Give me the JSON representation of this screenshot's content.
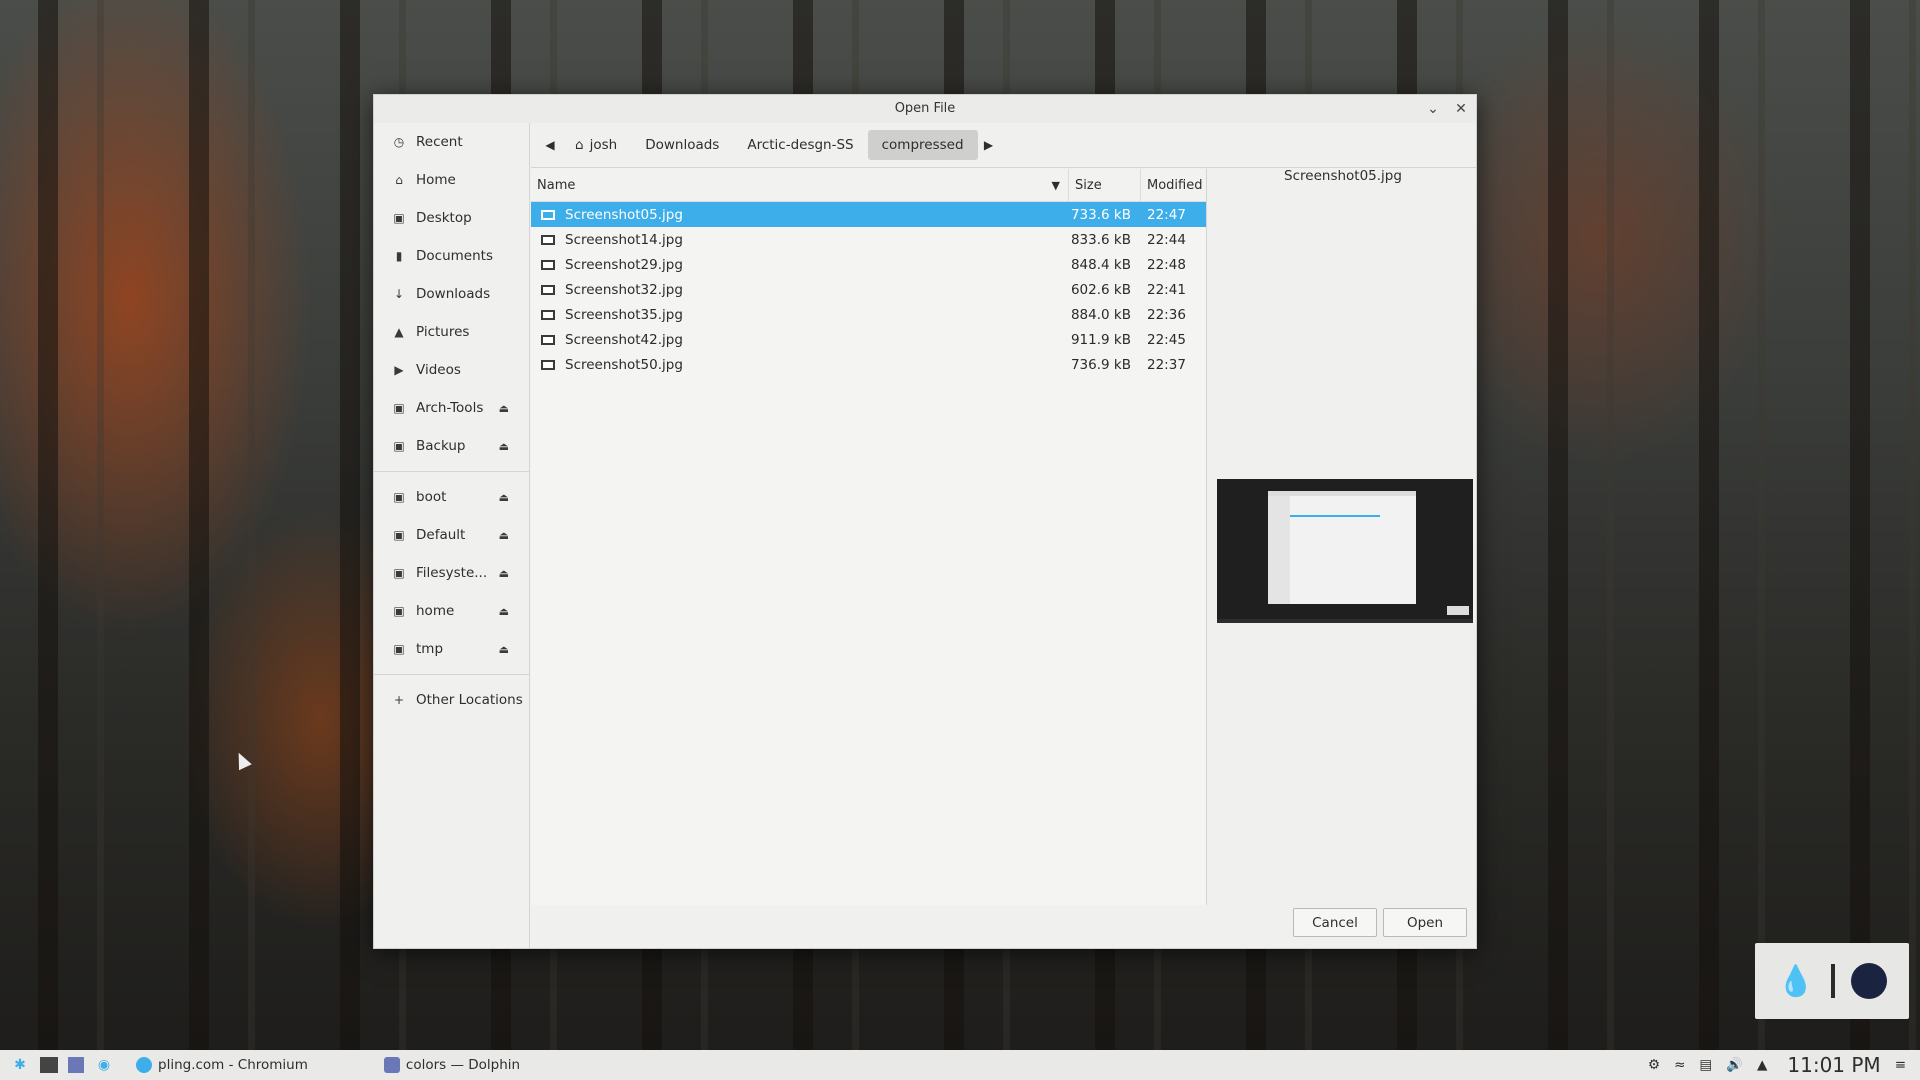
{
  "dialog": {
    "title": "Open File",
    "cancel_label": "Cancel",
    "open_label": "Open"
  },
  "sidebar": {
    "places": [
      {
        "label": "Recent",
        "icon": "clock-icon"
      },
      {
        "label": "Home",
        "icon": "home-icon"
      },
      {
        "label": "Desktop",
        "icon": "desktop-icon"
      },
      {
        "label": "Documents",
        "icon": "document-icon"
      },
      {
        "label": "Downloads",
        "icon": "download-icon"
      },
      {
        "label": "Pictures",
        "icon": "picture-icon"
      },
      {
        "label": "Videos",
        "icon": "video-icon"
      },
      {
        "label": "Arch-Tools",
        "icon": "drive-icon"
      },
      {
        "label": "Backup",
        "icon": "drive-icon"
      }
    ],
    "devices": [
      {
        "label": "boot"
      },
      {
        "label": "Default"
      },
      {
        "label": "Filesyste..."
      },
      {
        "label": "home"
      },
      {
        "label": "tmp"
      }
    ],
    "other_locations": "Other Locations"
  },
  "pathbar": {
    "crumbs": [
      "josh",
      "Downloads",
      "Arctic-desgn-SS",
      "compressed"
    ],
    "active": "compressed"
  },
  "filelist": {
    "columns": {
      "name": "Name",
      "size": "Size",
      "modified": "Modified"
    },
    "rows": [
      {
        "name": "Screenshot05.jpg",
        "size": "733.6 kB",
        "modified": "22:47",
        "selected": true
      },
      {
        "name": "Screenshot14.jpg",
        "size": "833.6 kB",
        "modified": "22:44"
      },
      {
        "name": "Screenshot29.jpg",
        "size": "848.4 kB",
        "modified": "22:48"
      },
      {
        "name": "Screenshot32.jpg",
        "size": "602.6 kB",
        "modified": "22:41"
      },
      {
        "name": "Screenshot35.jpg",
        "size": "884.0 kB",
        "modified": "22:36"
      },
      {
        "name": "Screenshot42.jpg",
        "size": "911.9 kB",
        "modified": "22:45"
      },
      {
        "name": "Screenshot50.jpg",
        "size": "736.9 kB",
        "modified": "22:37"
      }
    ]
  },
  "preview": {
    "filename": "Screenshot05.jpg"
  },
  "taskbar": {
    "tasks": [
      {
        "label": "pling.com - Chromium"
      },
      {
        "label": "colors — Dolphin"
      }
    ],
    "clock": "11:01 PM"
  },
  "colors": {
    "selection": "#3daee9",
    "dialog_bg": "#f0f0ef"
  }
}
